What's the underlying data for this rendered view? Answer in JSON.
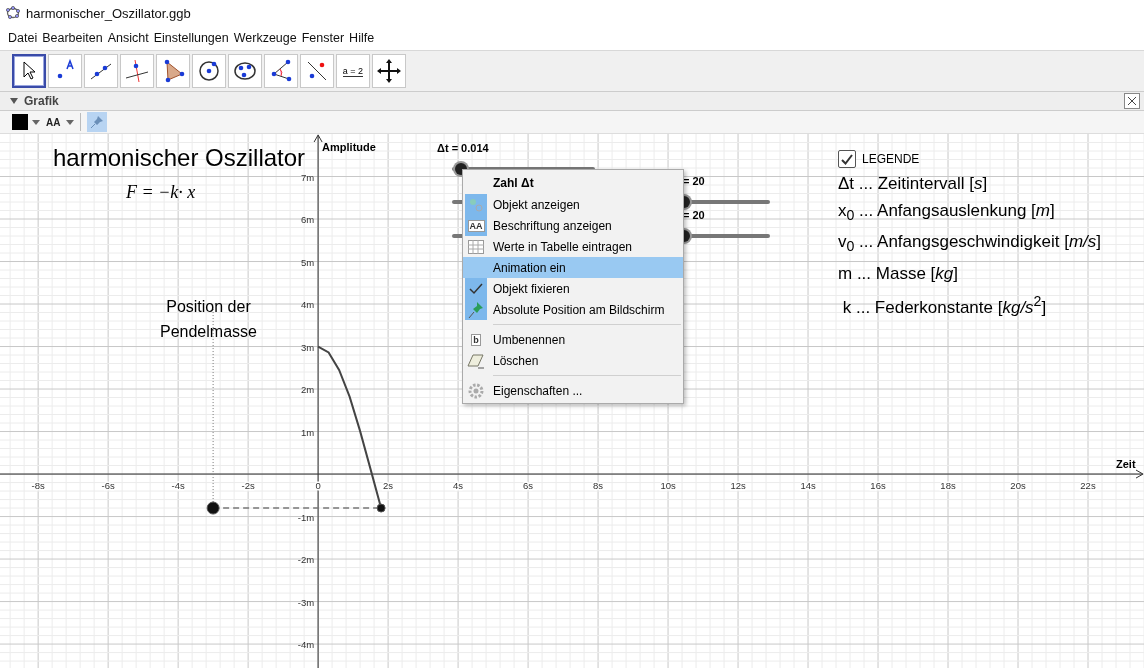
{
  "window": {
    "title": "harmonischer_Oszillator.ggb"
  },
  "menu_bar": [
    "Datei",
    "Bearbeiten",
    "Ansicht",
    "Einstellungen",
    "Werkzeuge",
    "Fenster",
    "Hilfe"
  ],
  "toolbar": [
    {
      "selected": true
    },
    {
      "selected": false
    },
    {
      "selected": false
    },
    {
      "selected": false
    },
    {
      "selected": false
    },
    {
      "selected": false
    },
    {
      "selected": false
    },
    {
      "selected": false
    },
    {
      "selected": false
    },
    {
      "selected": false,
      "label": "a = 2"
    },
    {
      "selected": false
    }
  ],
  "panel": {
    "title": "Grafik",
    "style_bar": {
      "text_size_label": "AA",
      "pin_selected": true
    }
  },
  "graphics": {
    "title": "harmonischer Oszillator",
    "formula": "F = −k· x",
    "caption": "Position der\nPendelmasse",
    "sliders": [
      {
        "label": "Δt = 0.014",
        "level": 0.06
      },
      {
        "label": "= 20",
        "level": 0.73
      },
      {
        "label": "= 20",
        "level": 0.73
      }
    ],
    "legend": {
      "label": "LEGENDE",
      "checked": true,
      "lines": [
        "Δt ... Zeitintervall [*s*]",
        "x$_{0}$ ... Anfangsauslenkung [*m*]",
        "v$_{0}$ ... Anfangsgeschwindigkeit [*m/s*]",
        "m ... Masse [*kg*]",
        " k ... Federkonstante [*kg/s*$^{2}$]"
      ]
    },
    "chart_data": {
      "type": "line",
      "grid": true,
      "xlabel": "Zeit",
      "ylabel": "Amplitude",
      "xlim": [
        -9.09,
        23.6
      ],
      "ylim": [
        -4.61,
        8.0
      ],
      "xticks": [
        {
          "value": -8,
          "label": "-8s"
        },
        {
          "value": -6,
          "label": "-6s"
        },
        {
          "value": -4,
          "label": "-4s"
        },
        {
          "value": -2,
          "label": "-2s"
        },
        {
          "value": 0,
          "label": "0"
        },
        {
          "value": 2,
          "label": "2s"
        },
        {
          "value": 4,
          "label": "4s"
        },
        {
          "value": 6,
          "label": "6s"
        },
        {
          "value": 8,
          "label": "8s"
        },
        {
          "value": 10,
          "label": "10s"
        },
        {
          "value": 12,
          "label": "12s"
        },
        {
          "value": 14,
          "label": "14s"
        },
        {
          "value": 16,
          "label": "16s"
        },
        {
          "value": 18,
          "label": "18s"
        },
        {
          "value": 20,
          "label": "20s"
        },
        {
          "value": 22,
          "label": "22s"
        }
      ],
      "yticks": [
        {
          "value": 7,
          "label": "7m"
        },
        {
          "value": 6,
          "label": "6m"
        },
        {
          "value": 5,
          "label": "5m"
        },
        {
          "value": 4,
          "label": "4m"
        },
        {
          "value": 3,
          "label": "3m"
        },
        {
          "value": 2,
          "label": "2m"
        },
        {
          "value": 1,
          "label": "1m"
        },
        {
          "value": -1,
          "label": "-1m"
        },
        {
          "value": -2,
          "label": "-2m"
        },
        {
          "value": -3,
          "label": "-3m"
        },
        {
          "value": -4,
          "label": "-4m"
        }
      ],
      "x": [
        0,
        0.3,
        0.6,
        0.9,
        1.2,
        1.5,
        1.8
      ],
      "series": [
        {
          "color": "#444444",
          "values": [
            3,
            2.86,
            2.45,
            1.82,
            1.01,
            0.11,
            -0.8
          ]
        }
      ]
    }
  },
  "context_menu": {
    "title": "Zahl Δt",
    "groups": [
      [
        {
          "label": "Objekt anzeigen",
          "checked": true,
          "selected": false
        },
        {
          "label": "Beschriftung anzeigen",
          "checked": true,
          "selected": false,
          "icon_text": "AA"
        },
        {
          "label": "Werte in Tabelle eintragen",
          "checked": false,
          "selected": false
        },
        {
          "label": "Animation ein",
          "checked": false,
          "selected": true
        },
        {
          "label": "Objekt fixieren",
          "checked": true,
          "selected": false
        },
        {
          "label": "Absolute Position am Bildschirm",
          "checked": true,
          "selected": false
        }
      ],
      [
        {
          "label": "Umbenennen",
          "checked": false,
          "selected": false,
          "icon_text": "b"
        },
        {
          "label": "Löschen",
          "checked": false,
          "selected": false
        }
      ],
      [
        {
          "label": "Eigenschaften ...",
          "checked": false,
          "selected": false
        }
      ]
    ]
  }
}
